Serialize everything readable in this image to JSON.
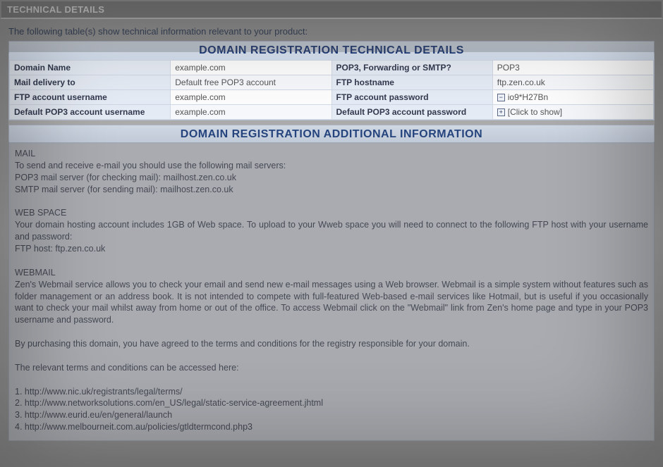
{
  "header": {
    "title": "TECHNICAL DETAILS"
  },
  "intro": "The following table(s) show technical information relevant to your product:",
  "tech_table": {
    "title": "DOMAIN REGISTRATION TECHNICAL DETAILS",
    "rows": [
      {
        "l1": "Domain Name",
        "v1": "example.com",
        "l2": "POP3, Forwarding or SMTP?",
        "v2": "POP3"
      },
      {
        "l1": "Mail delivery to",
        "v1": "Default free POP3 account",
        "l2": "FTP hostname",
        "v2": "ftp.zen.co.uk"
      },
      {
        "l1": "FTP account username",
        "v1": "example.com",
        "l2": "FTP account password",
        "v2": "io9*H27Bn",
        "toggle2": "minus"
      },
      {
        "l1": "Default POP3 account username",
        "v1": "example.com",
        "l2": "Default POP3 account password",
        "v2": "[Click to show]",
        "toggle2": "plus"
      }
    ]
  },
  "additional": {
    "title": "DOMAIN REGISTRATION ADDITIONAL INFORMATION",
    "mail_header": "MAIL",
    "mail_line1": "To send and receive e-mail you should use the following mail servers:",
    "mail_line2": "POP3 mail server (for checking mail): mailhost.zen.co.uk",
    "mail_line3": "SMTP mail server (for sending mail): mailhost.zen.co.uk",
    "web_header": "WEB SPACE",
    "web_line1": "Your domain hosting account includes 1GB of Web space. To upload to your Wweb space you will need to connect to the following FTP host with your username and password:",
    "web_line2": "FTP host: ftp.zen.co.uk",
    "webmail_header": "WEBMAIL",
    "webmail_body": "Zen's Webmail service allows you to check your email and send new e-mail messages using a Web browser. Webmail is a simple system without features such as folder management or an address book. It is not intended to compete with full-featured Web-based e-mail services like Hotmail, but is useful if you occasionally want to check your mail whilst away from home or out of the office. To access Webmail click on the \"Webmail\" link from Zen's home page and type in your POP3 username and password.",
    "purchase": "By purchasing this domain, you have agreed to the terms and conditions for the registry responsible for your domain.",
    "terms_intro": "The relevant terms and conditions can be accessed here:",
    "terms": [
      "1. http://www.nic.uk/registrants/legal/terms/",
      "2. http://www.networksolutions.com/en_US/legal/static-service-agreement.jhtml",
      "3. http://www.eurid.eu/en/general/launch",
      "4. http://www.melbourneit.com.au/policies/gtldtermcond.php3"
    ]
  },
  "icons": {
    "minus": "−",
    "plus": "+"
  }
}
